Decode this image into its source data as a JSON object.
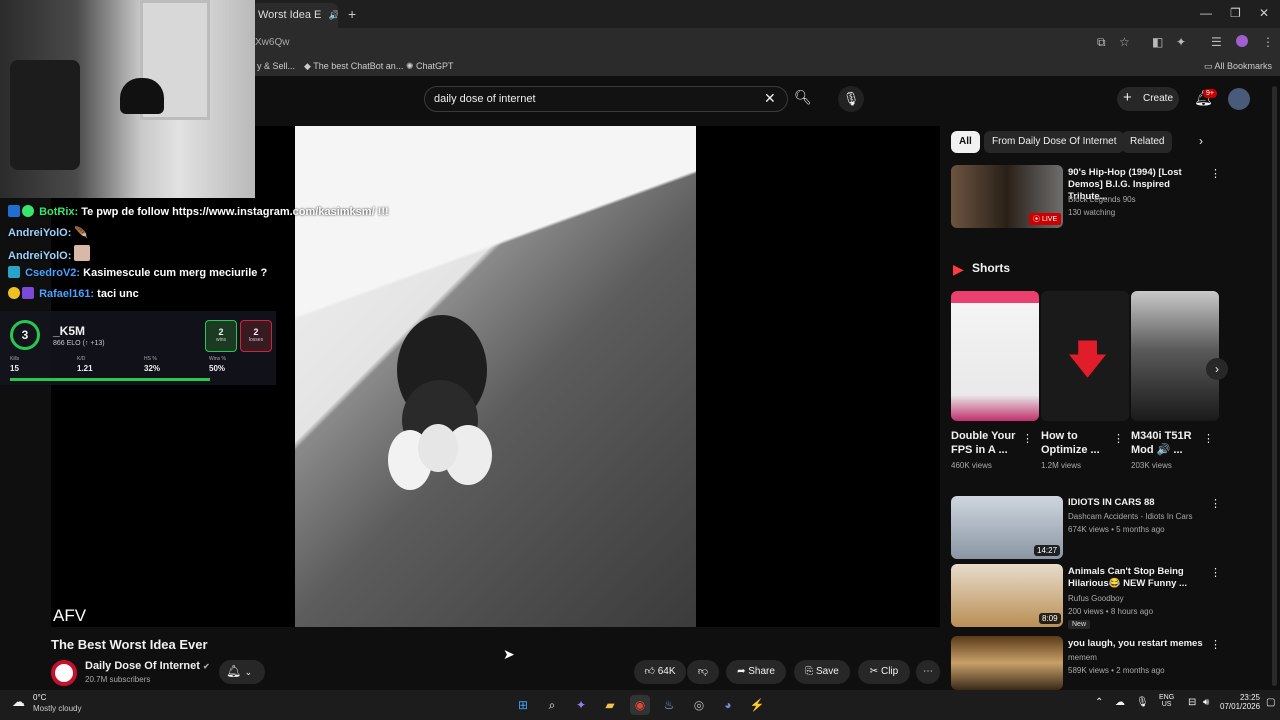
{
  "browser": {
    "tab_title": "Worst Idea E",
    "url_fragment": "Xw6Qw",
    "bookmarks": [
      "y & Sell...",
      "The best ChatBot an...",
      "ChatGPT"
    ],
    "all_bookmarks": "All Bookmarks"
  },
  "header": {
    "search_query": "daily dose of internet",
    "create_label": "Create",
    "notification_badge": "9+"
  },
  "stream_overlay": {
    "chat": [
      {
        "user": "BotRix:",
        "user_color": "#3ae46e",
        "text": "Te pwp de follow https://www.instagram.com/kasimksm/ !!!"
      },
      {
        "user": "AndreiYolO:",
        "user_color": "#9ad1ff",
        "text": ""
      },
      {
        "user": "AndreiYolO:",
        "user_color": "#9ad1ff",
        "text": ""
      },
      {
        "user": "CsedroV2:",
        "user_color": "#4aa3ff",
        "text": "Kasimescule cum merg meciurile ?"
      },
      {
        "user": "Rafael161:",
        "user_color": "#4aa3ff",
        "text": "taci unc"
      }
    ],
    "stats": {
      "level": "3",
      "name": "_K5M",
      "elo": "866 ELO (↑ +13)",
      "wins": "2",
      "wins_label": "wins",
      "losses": "2",
      "losses_label": "losses",
      "labels": [
        "Kills",
        "K/D",
        "HS %",
        "Wins %"
      ],
      "values": [
        "15",
        "1.21",
        "32%",
        "50%"
      ]
    }
  },
  "player": {
    "watermark": "AFV"
  },
  "video": {
    "title": "The Best Worst Idea Ever",
    "channel": "Daily Dose Of Internet",
    "verified": "✔",
    "subscribers": "20.7M subscribers",
    "likes": "64K",
    "share": "Share",
    "save": "Save",
    "clip": "Clip"
  },
  "sidebar": {
    "chips": [
      "All",
      "From Daily Dose Of Internet",
      "Related"
    ],
    "live": {
      "title": "90's Hip-Hop (1994) [Lost Demos] B.I.G. Inspired Tribute...",
      "channel": "Block Legends 90s",
      "meta": "130 watching",
      "badge": "LIVE"
    },
    "shorts_heading": "Shorts",
    "shorts": [
      {
        "title": "Double Your FPS in A ...",
        "views": "460K views"
      },
      {
        "title": "How to Optimize ...",
        "views": "1.2M views"
      },
      {
        "title": "M340i T51R Mod 🔊 ...",
        "views": "203K views"
      }
    ],
    "videos": [
      {
        "title": "IDIOTS IN CARS 88",
        "channel": "Dashcam Accidents - Idiots In Cars",
        "meta": "674K views • 5 months ago",
        "duration": "14:27",
        "badge": ""
      },
      {
        "title": "Animals Can't Stop Being Hilarious😂 NEW Funny ...",
        "channel": "Rufus Goodboy",
        "meta": "200 views • 8 hours ago",
        "duration": "8:09",
        "badge": "New"
      },
      {
        "title": "you laugh, you restart memes",
        "channel": "memem",
        "meta": "589K views • 2 months ago",
        "duration": "",
        "badge": ""
      }
    ]
  },
  "taskbar": {
    "temp": "0°C",
    "weather": "Mostly cloudy",
    "lang1": "ENG",
    "lang2": "US",
    "time": "23:25",
    "date": "07/01/2026"
  }
}
